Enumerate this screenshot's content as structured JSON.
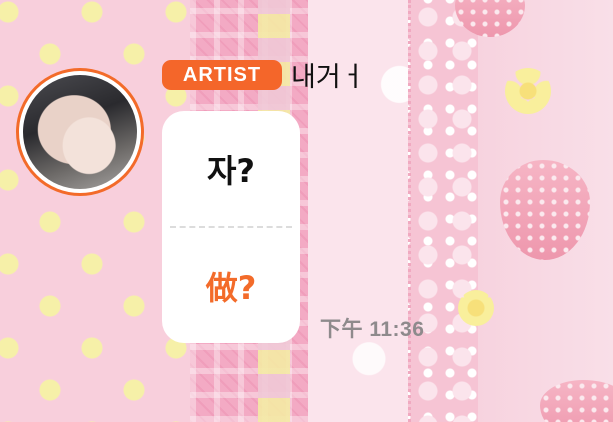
{
  "chat": {
    "sender": {
      "badge": "ARTIST",
      "name": "내거ㅓ",
      "avatar_icon": "profile-photo"
    },
    "message": {
      "original_text": "자?",
      "translated_text": "做?",
      "timestamp": "下午 11:36"
    }
  },
  "colors": {
    "accent": "#f36b2a",
    "bubble": "#ffffff",
    "timestamp": "#8e8a8c"
  }
}
